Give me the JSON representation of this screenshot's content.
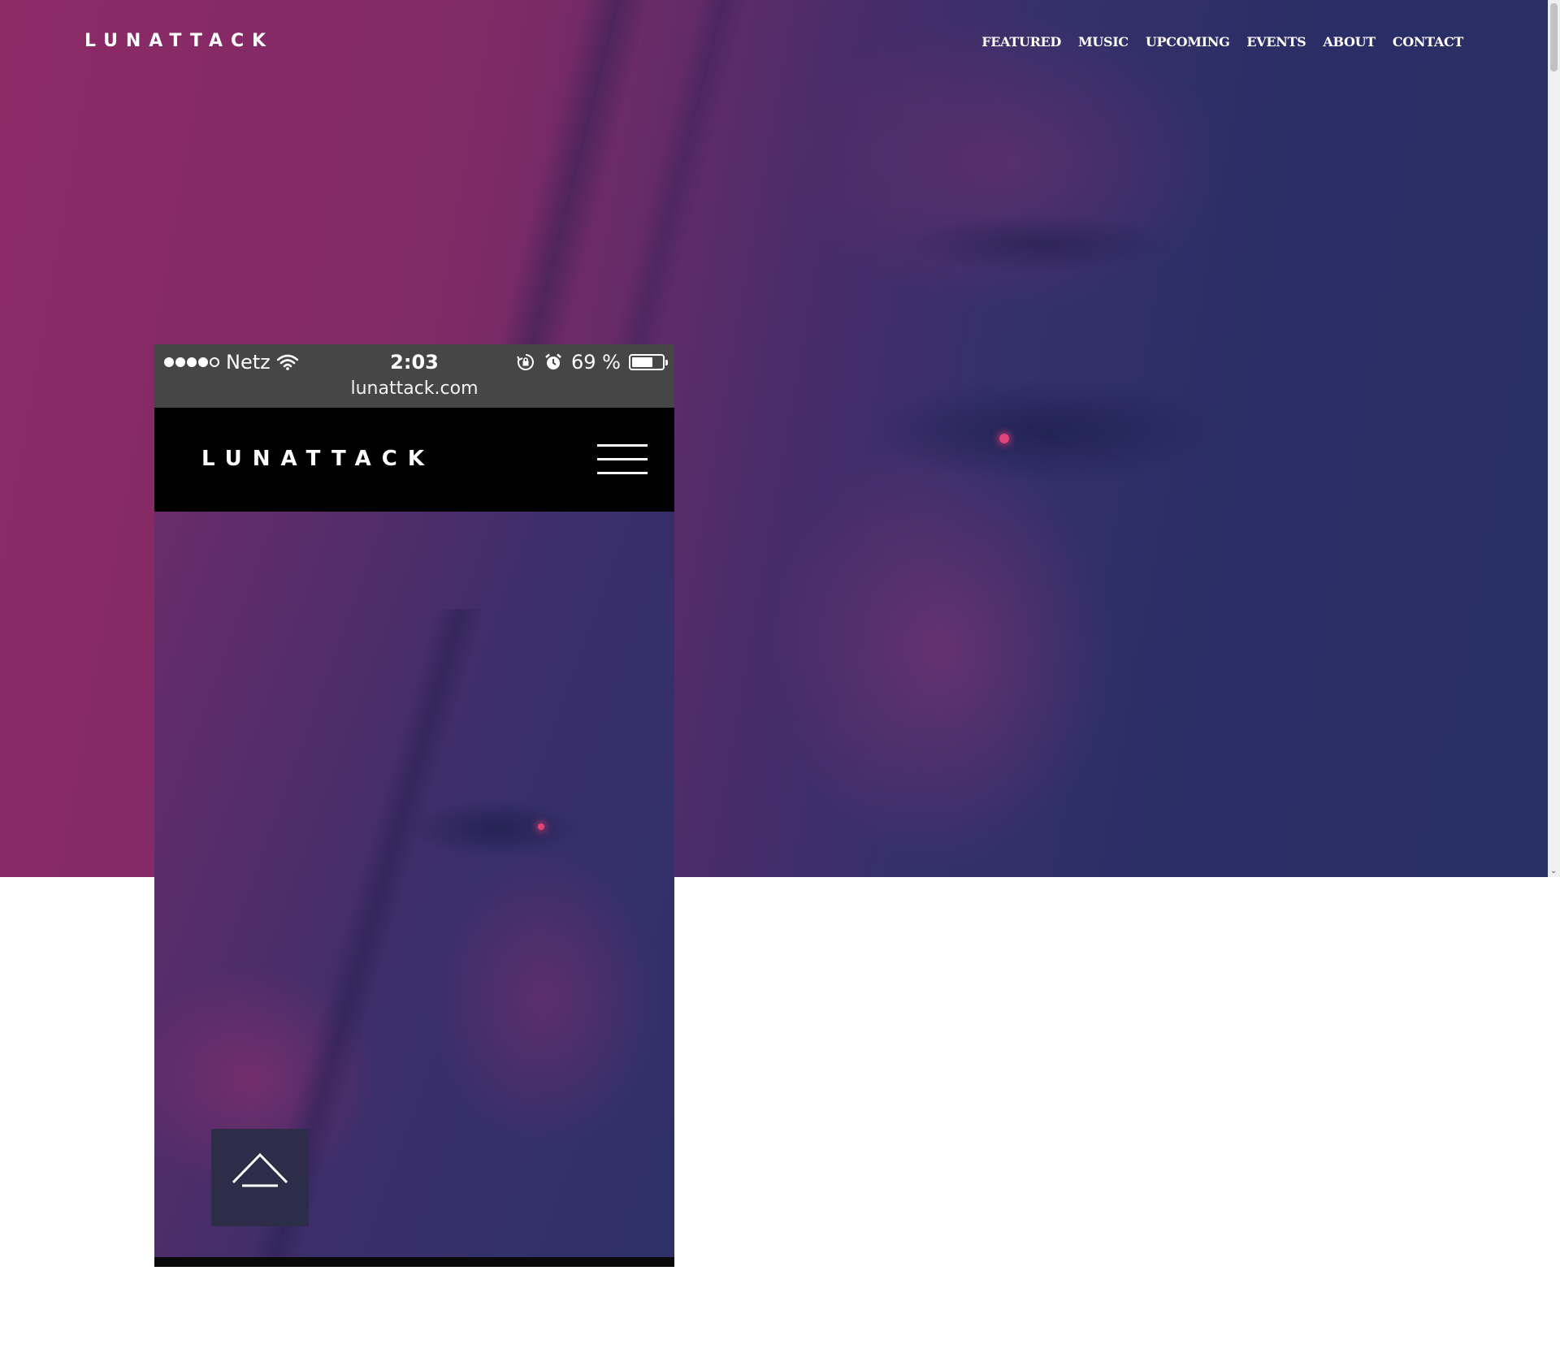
{
  "site": {
    "logo": "LUNATTACK",
    "nav": [
      "FEATURED",
      "MUSIC",
      "UPCOMING",
      "EVENTS",
      "ABOUT",
      "CONTACT"
    ]
  },
  "phone": {
    "carrier": "Netz",
    "time": "2:03",
    "battery": "69 %",
    "battery_level": 0.69,
    "url": "lunattack.com",
    "logo": "LUNATTACK"
  },
  "icons": {
    "wifi": "wifi-icon",
    "rotation_lock": "rotation-lock-icon",
    "alarm": "alarm-icon",
    "battery": "battery-icon",
    "menu": "hamburger-menu-icon",
    "scroll_top": "chevron-up-icon"
  },
  "colors": {
    "hero_magenta": "#8c2a66",
    "hero_navy": "#283064",
    "header_black": "#000000",
    "status_gray": "#464646"
  }
}
